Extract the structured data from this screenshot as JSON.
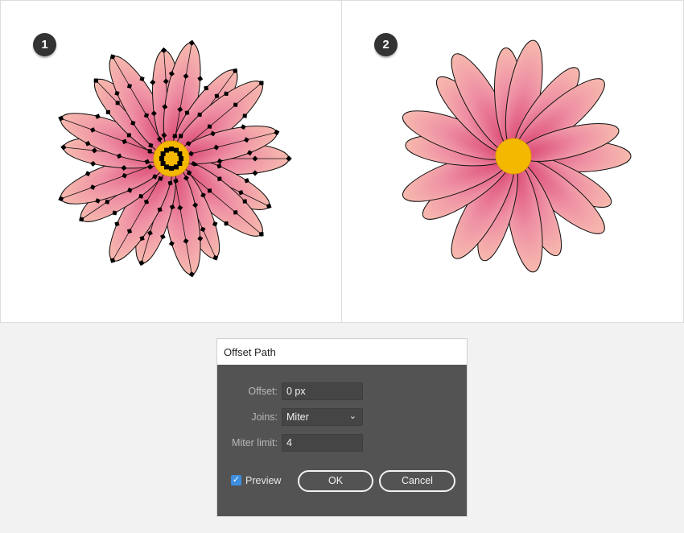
{
  "steps": [
    {
      "number": "1"
    },
    {
      "number": "2"
    }
  ],
  "colors": {
    "petal_light": "#f7b9ae",
    "petal_dark": "#d9406f",
    "center": "#f5b800",
    "dialog_bg": "#535353",
    "checkbox": "#3d8ee0"
  },
  "dialog": {
    "title": "Offset Path",
    "offset": {
      "label": "Offset:",
      "value": "0 px"
    },
    "joins": {
      "label": "Joins:",
      "value": "Miter"
    },
    "miter_limit": {
      "label": "Miter limit:",
      "value": "4"
    },
    "preview": {
      "label": "Preview",
      "checked": true
    },
    "ok_label": "OK",
    "cancel_label": "Cancel"
  }
}
